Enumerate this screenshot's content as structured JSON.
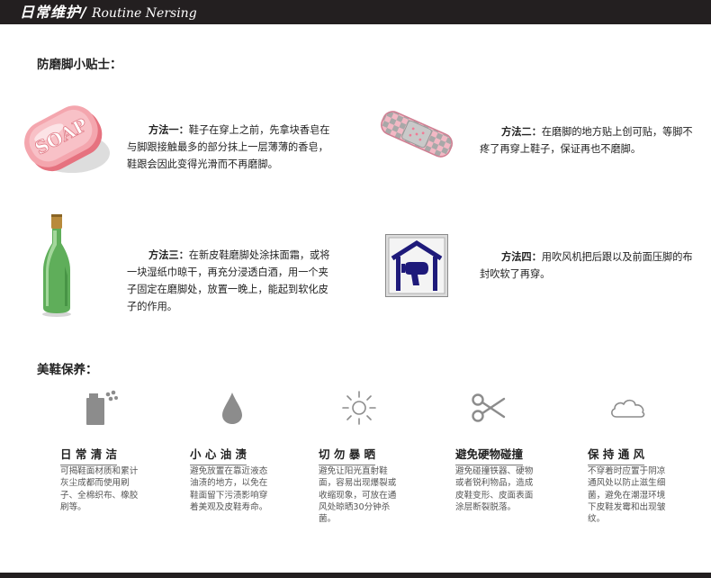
{
  "header": {
    "title_cn": "日常维护/",
    "title_en": "Routine Nersing"
  },
  "tips": {
    "title": "防磨脚小贴士：",
    "items": [
      {
        "icon": "soap-icon",
        "label": "方法一：",
        "text": "鞋子在穿上之前，先拿块香皂在与脚跟接触最多的部分抹上一层薄薄的香皂，鞋跟会因此变得光滑而不再磨脚。",
        "soap_word": "SOAP"
      },
      {
        "icon": "bandage-icon",
        "label": "方法二：",
        "text": "在磨脚的地方贴上创可贴，等脚不疼了再穿上鞋子，保证再也不磨脚。"
      },
      {
        "icon": "wine-bottle-icon",
        "label": "方法三：",
        "text": "在新皮鞋磨脚处涂抹面霜，或将一块湿纸巾晾干，再充分浸透白酒，用一个夹子固定在磨脚处，放置一晚上，能起到软化皮子的作用。"
      },
      {
        "icon": "hair-dryer-icon",
        "label": "方法四：",
        "text": "用吹风机把后跟以及前面压脚的布封吹软了再穿。"
      }
    ]
  },
  "care": {
    "title": "美鞋保养：",
    "items": [
      {
        "icon": "spray-can-icon",
        "title": "日 常 清 洁",
        "desc": "可揭鞋面材质和累计灰尘成都而使用刷子、全棉织布、橡胶刷等。"
      },
      {
        "icon": "water-drop-icon",
        "title": "小 心 油 渍",
        "desc": "避免放置在靠近液态油渍的地方，以免在鞋面留下污渍影响穿着美观及皮鞋寿命。"
      },
      {
        "icon": "sun-icon",
        "title": "切 勿 暴 晒",
        "desc": "避免让阳光直射鞋面，容易出现爆裂或收缩现象，可放在通风处晾晒30分钟杀菌。"
      },
      {
        "icon": "scissors-icon",
        "title": "避免硬物碰撞",
        "desc": "避免碰撞铁器、硬物或者锐利物品，造成皮鞋变形、皮面表面涂层断裂脱落。"
      },
      {
        "icon": "cloud-icon",
        "title": "保 持 通 风",
        "desc": "不穿着时应置于阴凉通风处以防止滋生细菌，避免在潮湿环境下皮鞋发霉和出现皱纹。"
      }
    ]
  },
  "colors": {
    "header_bg": "#231f20",
    "icon_gray": "#8c8c8c",
    "soap_pink": "#f08c97",
    "bottle_green": "#5fae5a",
    "dryer_blue": "#1e1a7a"
  }
}
